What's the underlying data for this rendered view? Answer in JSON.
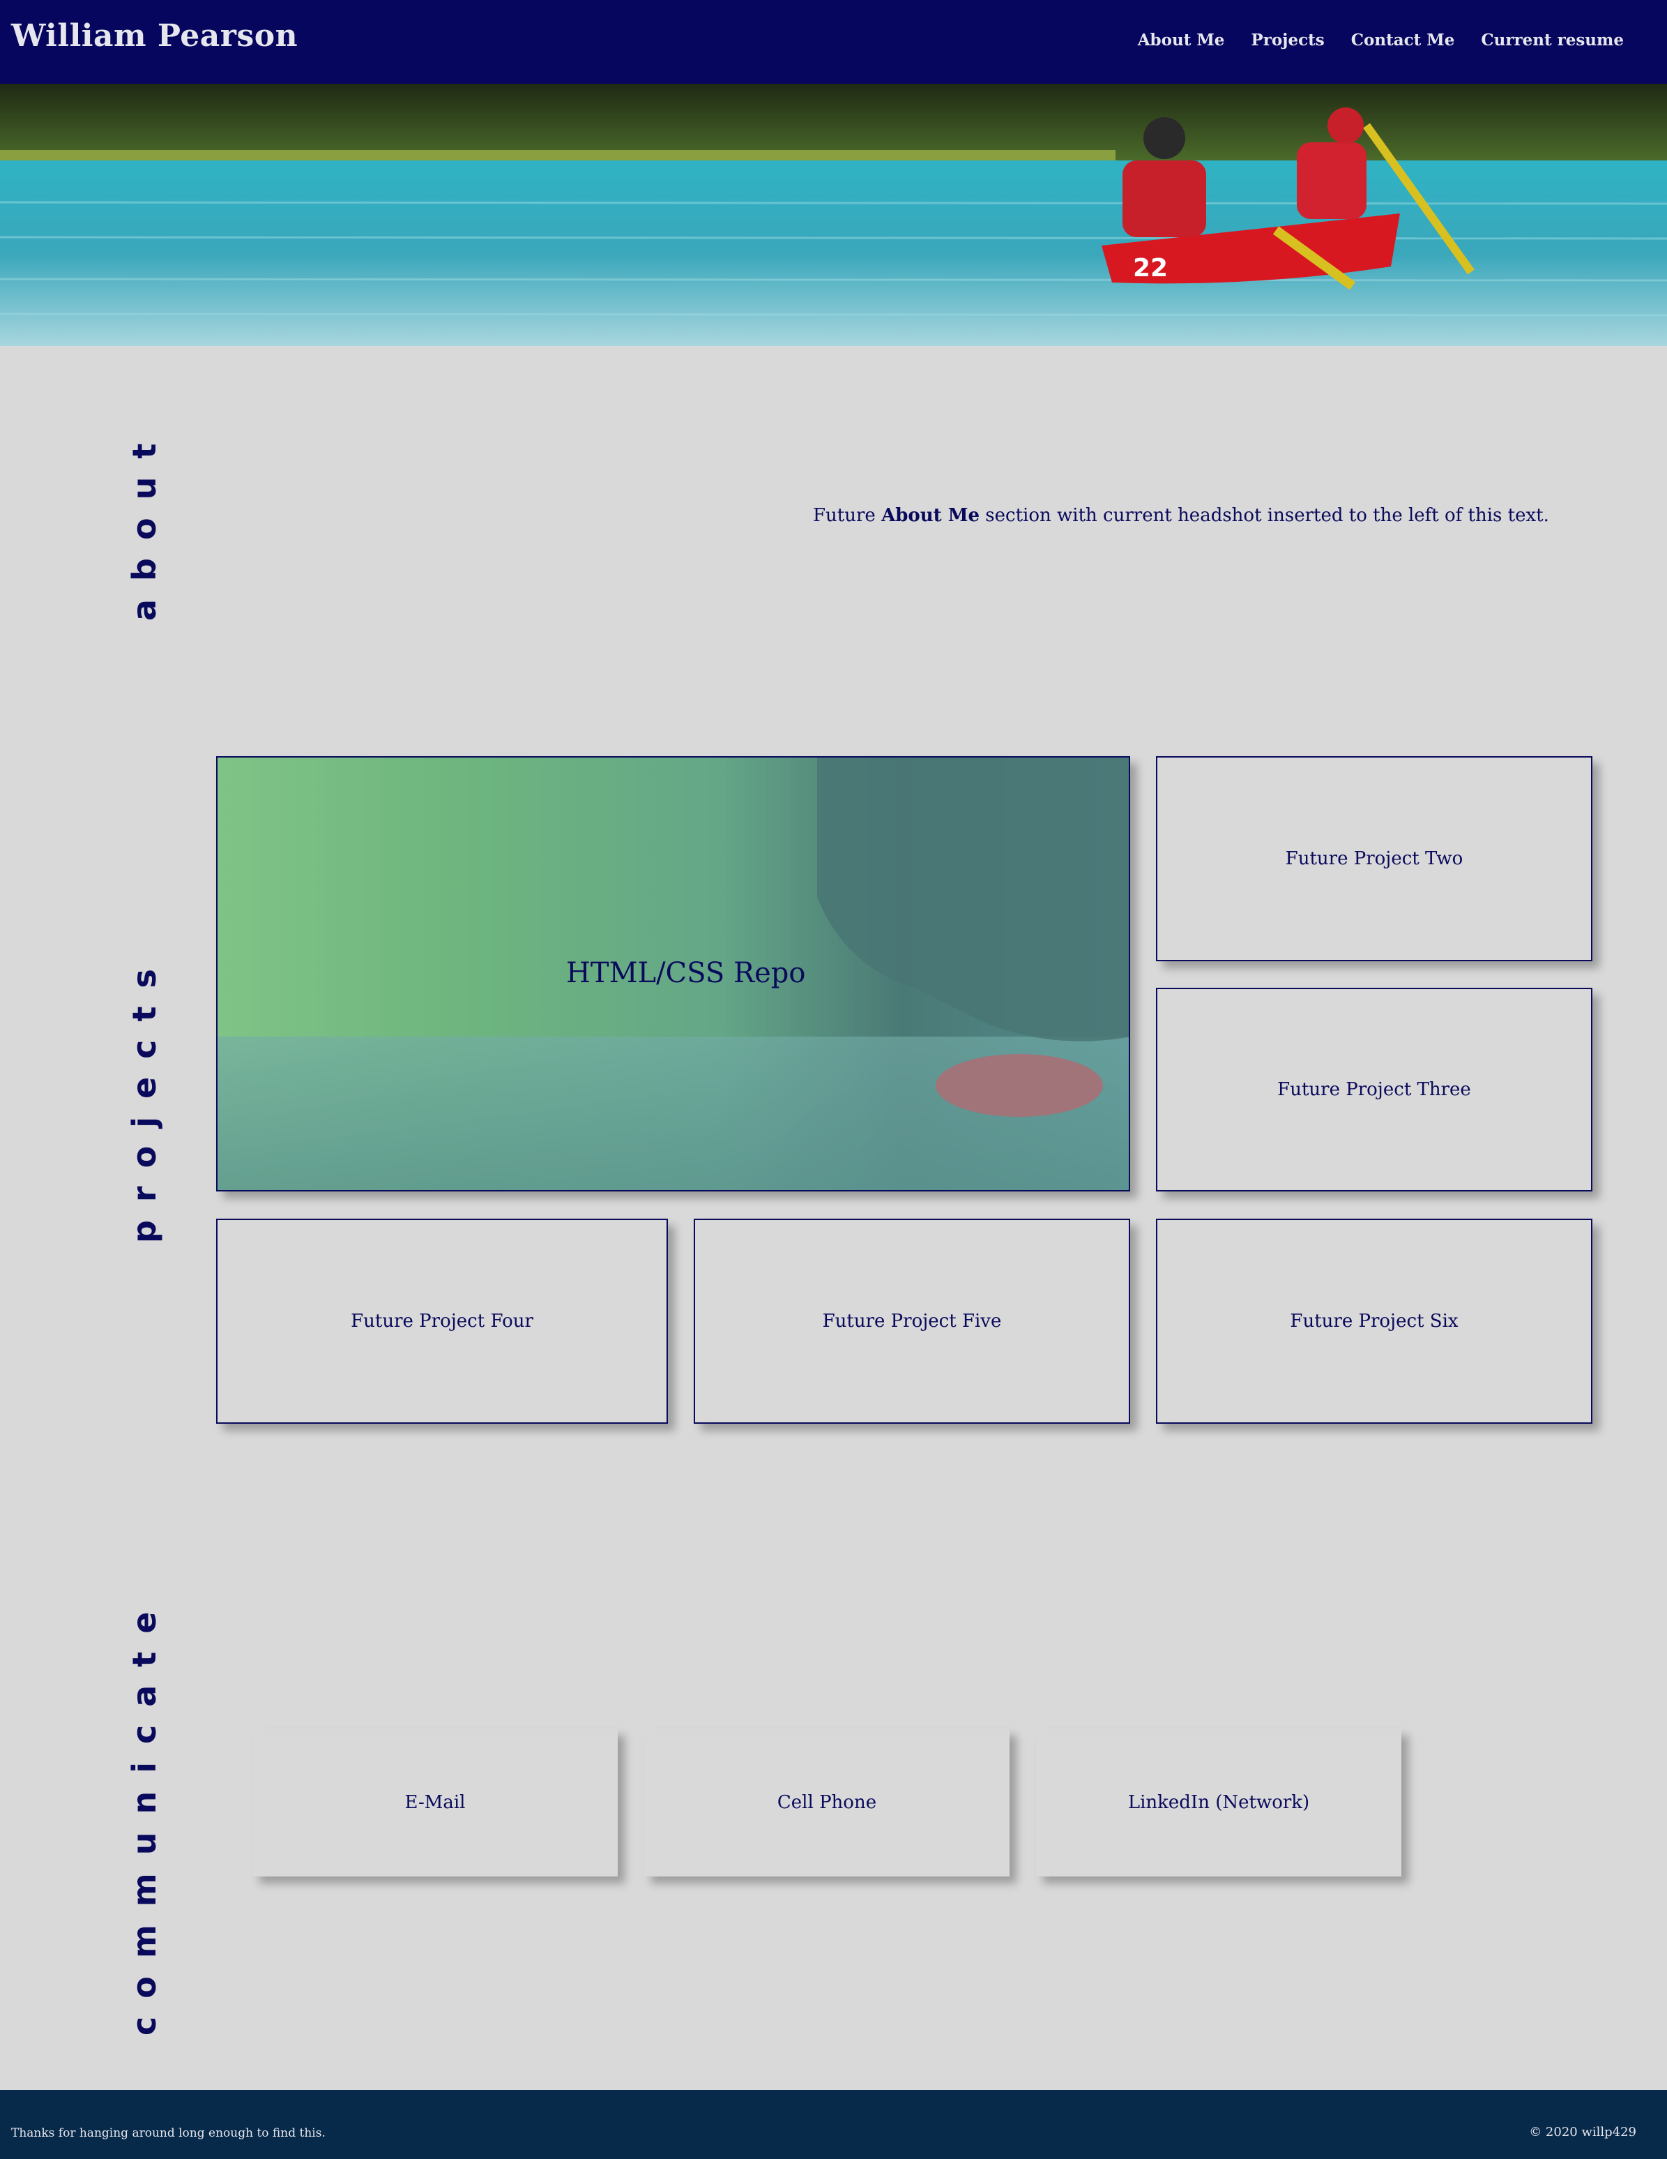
{
  "header": {
    "title": "William Pearson",
    "nav": [
      "About Me",
      "Projects",
      "Contact Me",
      "Current resume"
    ]
  },
  "sections": {
    "about_label": "about",
    "projects_label": "projects",
    "communicate_label": "communicate"
  },
  "about": {
    "prefix": "Future ",
    "bold": "About Me",
    "suffix": " section with current headshot inserted to the left of this text."
  },
  "projects": {
    "featured": "HTML/CSS Repo",
    "items": [
      "Future Project Two",
      "Future Project Three",
      "Future Project Four",
      "Future Project Five",
      "Future Project Six"
    ]
  },
  "contact": {
    "items": [
      "E-Mail",
      "Cell Phone",
      "LinkedIn (Network)"
    ]
  },
  "footer": {
    "left": "Thanks for hanging around long enough to find this.",
    "right": "© 2020 willp429"
  },
  "colors": {
    "header_bg": "#06065e",
    "page_bg": "#d9d9d9",
    "accent": "#0a0a5c",
    "footer_bg": "#082a4a"
  }
}
